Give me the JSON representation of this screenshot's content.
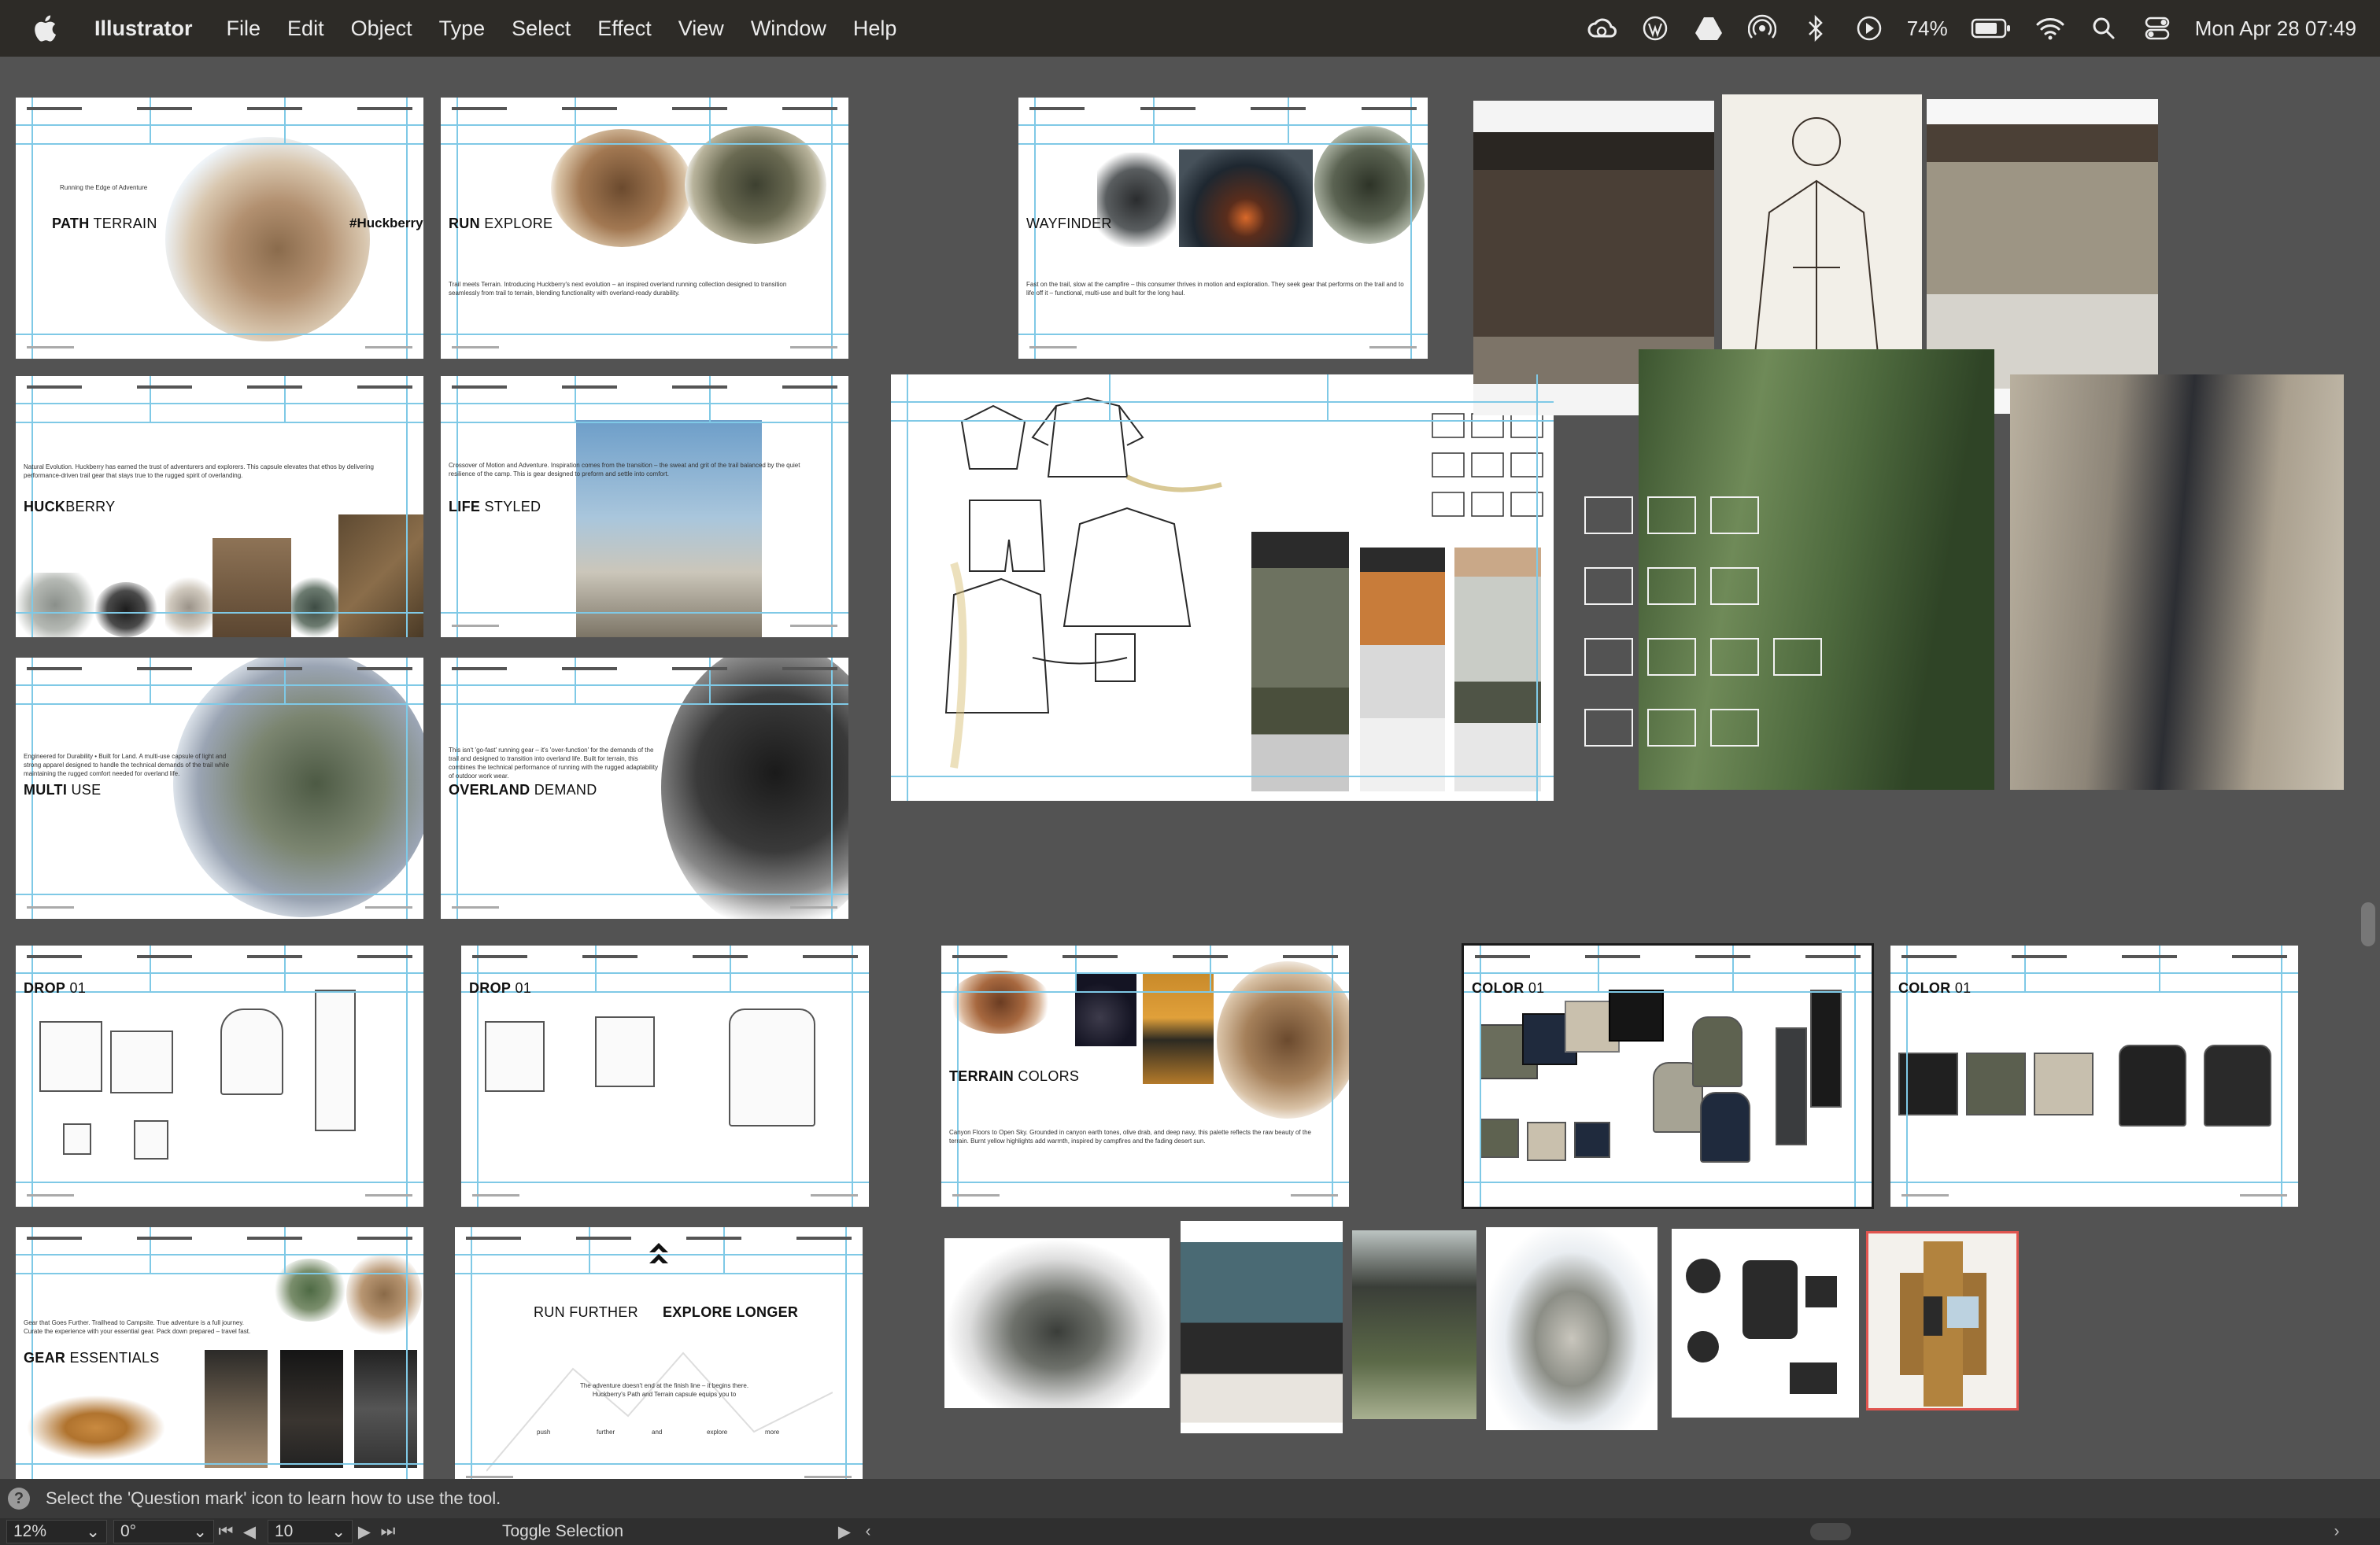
{
  "menubar": {
    "app": "Illustrator",
    "menus": [
      "File",
      "Edit",
      "Object",
      "Type",
      "Select",
      "Effect",
      "View",
      "Window",
      "Help"
    ],
    "battery": "74%",
    "datetime": "Mon Apr 28  07:49",
    "icons": [
      "creative-cloud-icon",
      "wordpress-icon",
      "google-drive-icon",
      "airdrop-icon",
      "bluetooth-icon",
      "play-icon",
      "battery-icon",
      "wifi-icon",
      "spotlight-icon",
      "control-center-icon"
    ]
  },
  "artboards": {
    "path_terrain": {
      "title_a": "PATH",
      "title_b": "TERRAIN",
      "tagline": "Running the Edge of Adventure",
      "brand": "#Huckberry"
    },
    "run_explore": {
      "title_a": "RUN",
      "title_b": "EXPLORE",
      "body": "Trail meets Terrain. Introducing Huckberry's next evolution – an inspired overland running collection designed to transition seamlessly from trail to terrain, blending functionality with overland-ready durability."
    },
    "wayfinder": {
      "title": "WAYFINDER",
      "body": "Fast on the trail, slow at the campfire – this consumer thrives in motion and exploration. They seek gear that performs on the trail and to life off it – functional, multi-use and built for the long haul."
    },
    "huckberry": {
      "title_a": "HUCK",
      "title_b": "BERRY",
      "body": "Natural Evolution. Huckberry has earned the trust of adventurers and explorers. This capsule elevates that ethos by delivering performance-driven trail gear that stays true to the rugged spirit of overlanding."
    },
    "life_styled": {
      "title_a": "LIFE",
      "title_b": "STYLED",
      "body": "Crossover of Motion and Adventure. Inspiration comes from the transition – the sweat and grit of the trail balanced by the quiet resilience of the camp. This is gear designed to preform and settle into comfort."
    },
    "multi_use": {
      "title_a": "MULTI",
      "title_b": "USE",
      "body": "Engineered for Durability • Built for Land. A multi-use capsule of light and strong apparel designed to handle the technical demands of the trail while maintaining the rugged comfort needed for overland life."
    },
    "overland_demand": {
      "title_a": "OVERLAND",
      "title_b": "DEMAND",
      "body": "This isn't 'go-fast' running gear – it's 'over-function' for the demands of the trail and designed to transition into overland life. Built for terrain, this combines the technical performance of running with the rugged adaptability of outdoor work wear."
    },
    "drop_01_a": {
      "title_a": "DROP",
      "title_b": "01"
    },
    "drop_01_b": {
      "title_a": "DROP",
      "title_b": "01"
    },
    "terrain_colors": {
      "title_a": "TERRAIN",
      "title_b": "COLORS",
      "body": "Canyon Floors to Open Sky. Grounded in canyon earth tones, olive drab, and deep navy, this palette reflects the raw beauty of the terrain. Burnt yellow highlights add warmth, inspired by campfires and the fading desert sun."
    },
    "color_01_a": {
      "title_a": "COLOR",
      "title_b": "01"
    },
    "color_01_b": {
      "title_a": "COLOR",
      "title_b": "01"
    },
    "gear_essentials": {
      "title_a": "GEAR",
      "title_b": "ESSENTIALS",
      "body": "Gear that Goes Further. Trailhead to Campsite. True adventure is a full journey. Curate the experience with your essential gear. Pack down prepared – travel fast."
    },
    "run_further": {
      "title_a": "RUN FURTHER",
      "title_b": "EXPLORE LONGER",
      "body": "The adventure doesn't end at the finish line – it begins there. Huckberry's Path and Terrain capsule equips you to",
      "words": [
        "push",
        "further",
        "and",
        "explore",
        "more"
      ]
    }
  },
  "hint": {
    "text": "Select the 'Question mark' icon to learn how to use the tool."
  },
  "controls": {
    "zoom": "12%",
    "rotation": "0°",
    "artboard_number": "10",
    "toggle": "Toggle Selection"
  }
}
